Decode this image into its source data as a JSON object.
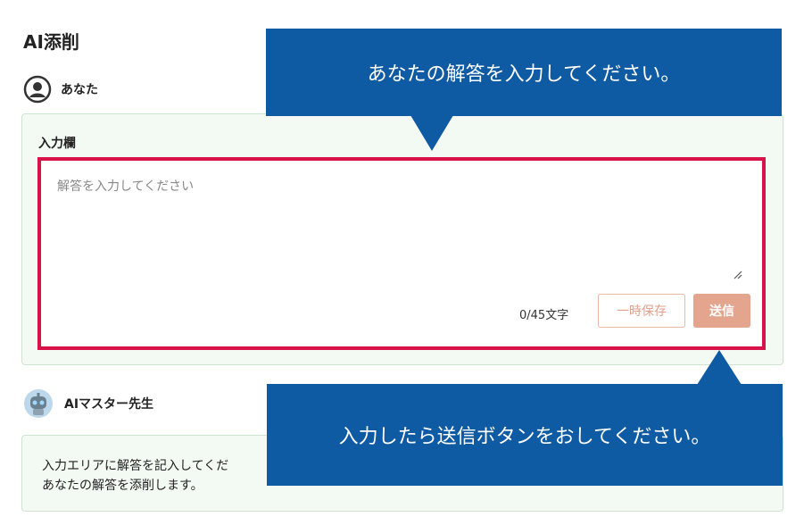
{
  "header": {
    "title": "AI添削"
  },
  "user": {
    "name": "あなた",
    "icon": "user-circle-icon"
  },
  "input": {
    "label": "入力欄",
    "placeholder": "解答を入力してください",
    "value": "",
    "counter": "0/45文字",
    "save_label": "一時保存",
    "send_label": "送信"
  },
  "ai": {
    "name": "AIマスター先生",
    "avatar_icon": "robot-avatar-icon",
    "message_line1": "入力エリアに解答を記入してくだ",
    "message_line2": "あなたの解答を添削します。"
  },
  "callouts": {
    "top": "あなたの解答を入力してください。",
    "bottom": "入力したら送信ボタンをおしてください。"
  },
  "colors": {
    "callout": "#0e5aa3",
    "highlight_border": "#d9124a",
    "card_bg": "#f3f9f3",
    "send_button": "#e4a58e"
  }
}
